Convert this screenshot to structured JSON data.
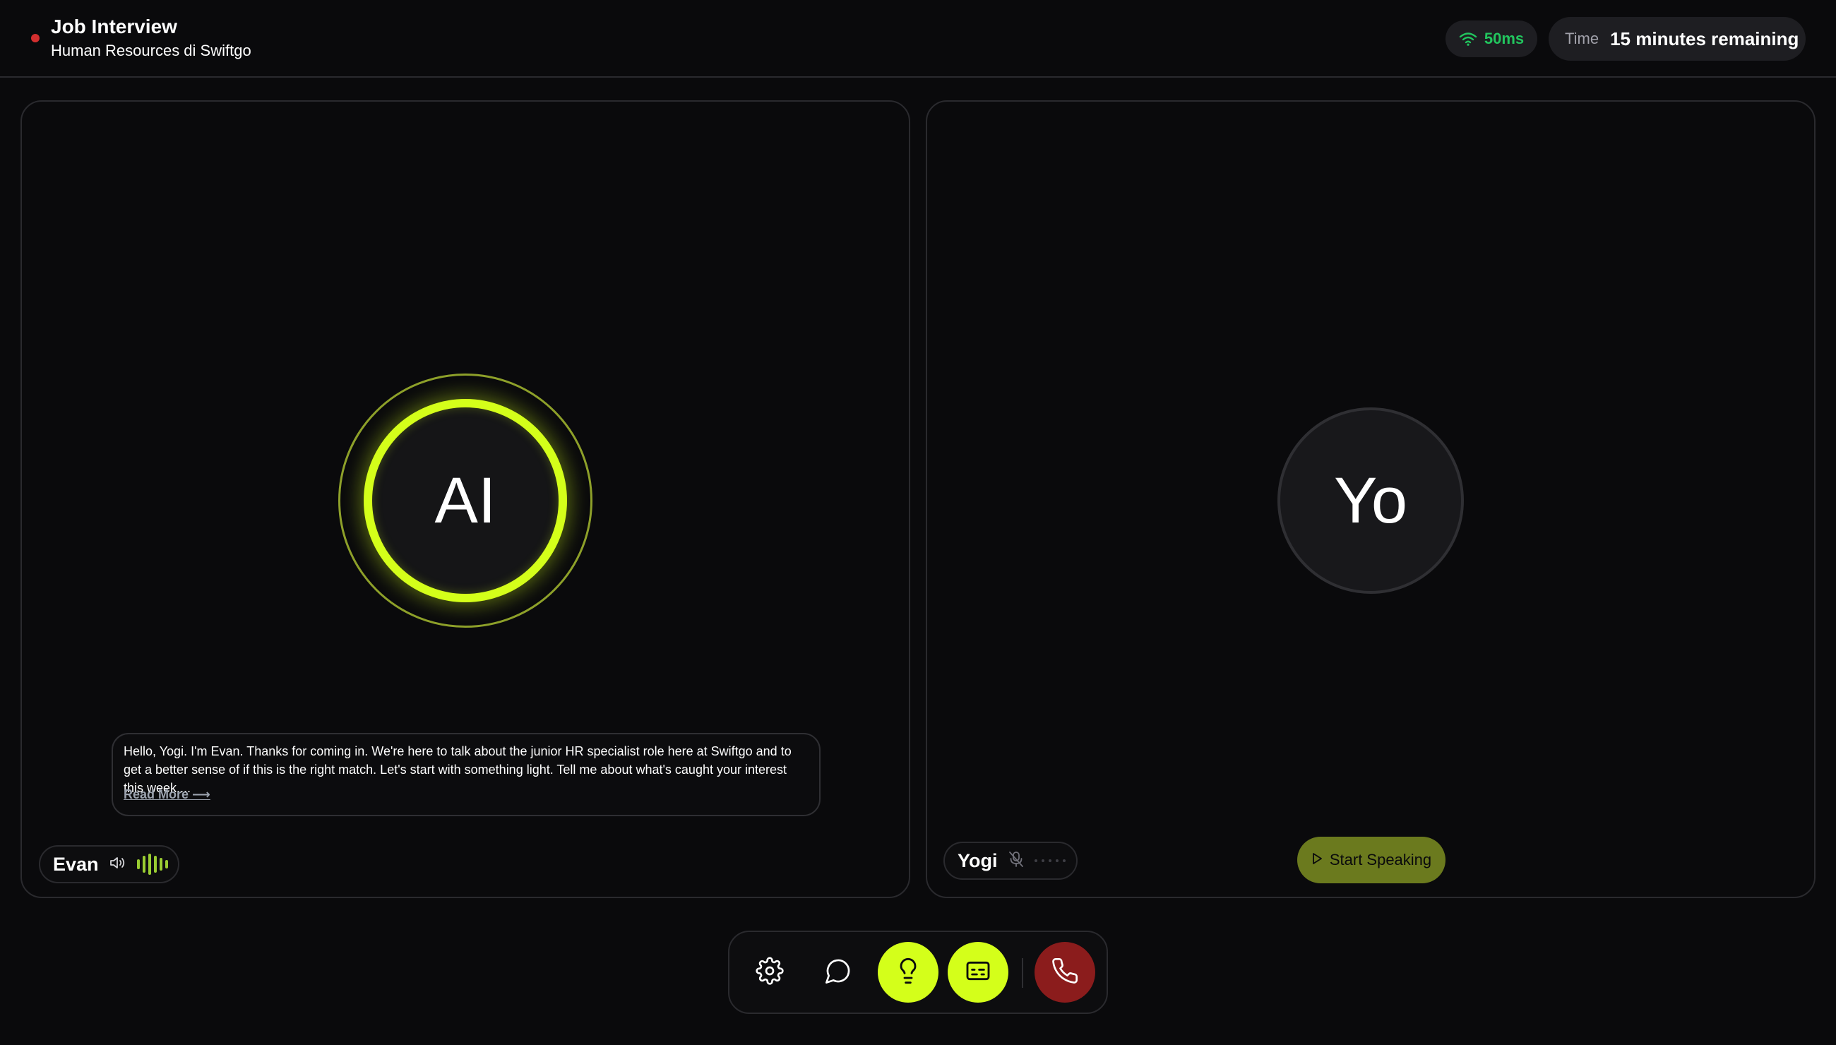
{
  "header": {
    "title": "Job Interview",
    "subtitle": "Human Resources di Swiftgo",
    "latency": "50ms",
    "timer_label": "Time",
    "timer_value": "15 minutes remaining"
  },
  "ai_panel": {
    "avatar_initials": "AI",
    "transcript": "Hello, Yogi. I'm Evan. Thanks for coming in. We're here to talk about the junior HR specialist role here at Swiftgo and to get a better sense of if this is the right match. Let's start with something light. Tell me about what's caught your interest this week....",
    "read_more": "Read More ⟶",
    "speaker_name": "Evan"
  },
  "user_panel": {
    "avatar_initials": "Yo",
    "speaker_name": "Yogi",
    "start_button": "Start Speaking"
  },
  "controls": {
    "settings_icon": "gear-icon",
    "chat_icon": "chat-bubble-icon",
    "hint_icon": "lightbulb-icon",
    "captions_icon": "captions-icon",
    "end_call_icon": "phone-icon"
  },
  "colors": {
    "background": "#0a0a0c",
    "accent": "#d4ff1a",
    "latency_green": "#22c55e",
    "end_call_red": "#8b1c1c",
    "recording_dot": "#d32f2f"
  }
}
